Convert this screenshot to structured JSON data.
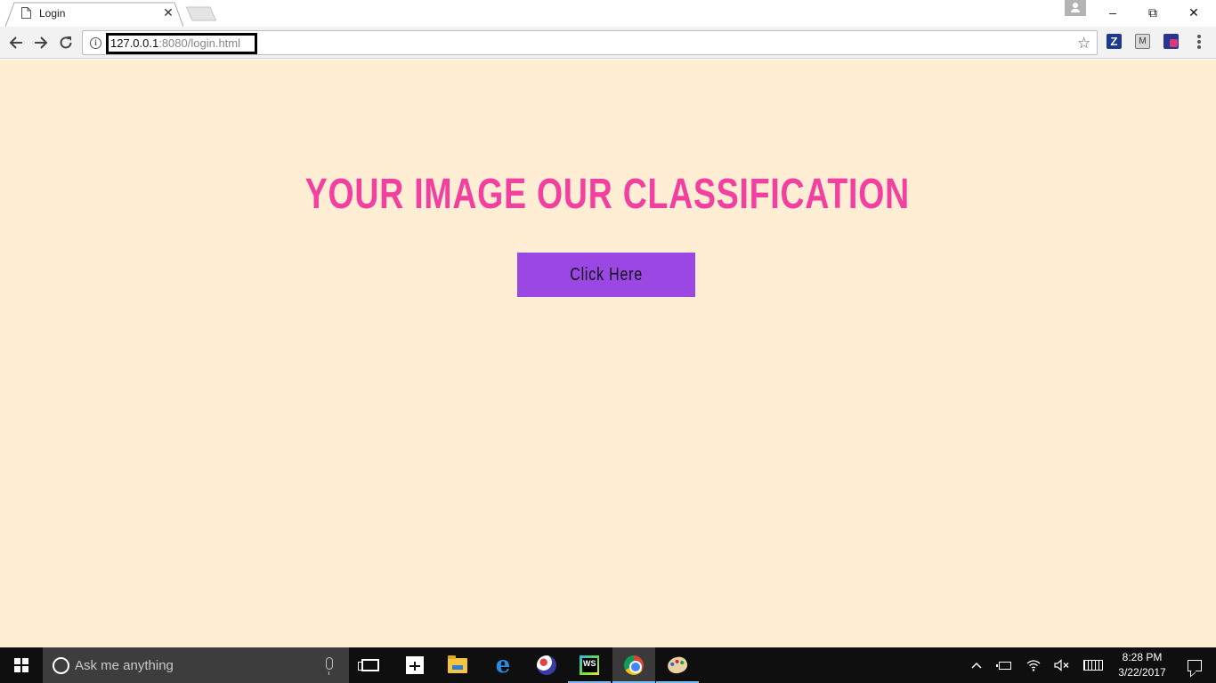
{
  "browser": {
    "tab": {
      "title": "Login",
      "icon": "page-icon",
      "close_icon": "close-icon"
    },
    "window_controls": {
      "minimize": "–",
      "restore": "⧉",
      "close": "✕"
    },
    "url": {
      "host": "127.0.0.1",
      "path": ":8080/login.html"
    },
    "extensions": {
      "z_label": "Z",
      "m_label": "M"
    }
  },
  "page": {
    "title": "YOUR IMAGE OUR CLASSIFICATION",
    "button_label": "Click Here",
    "colors": {
      "background": "#ffeed4",
      "title": "#f23fa0",
      "button": "#9b47e3"
    }
  },
  "taskbar": {
    "search_placeholder": "Ask me anything",
    "apps": [
      "task-view",
      "store",
      "file-explorer",
      "edge",
      "paint",
      "webstorm",
      "chrome",
      "paint-palette"
    ],
    "clock": {
      "time": "8:28 PM",
      "date": "3/22/2017"
    },
    "tray_chevron": "^"
  }
}
